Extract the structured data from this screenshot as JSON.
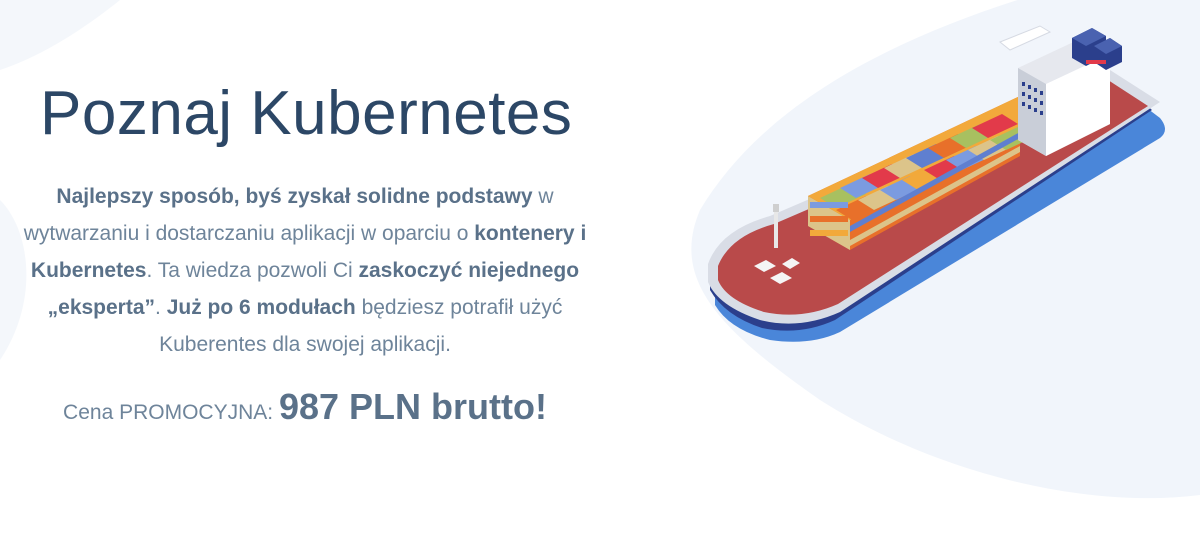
{
  "hero": {
    "title": "Poznaj Kubernetes",
    "description": {
      "p1_bold": "Najlepszy sposób, byś zyskał solidne podstawy",
      "p2": " w wytwarzaniu i dostarczaniu aplikacji w oparciu o ",
      "p3_bold": "kontenery i Kubernetes",
      "p4": ". Ta wiedza pozwoli Ci ",
      "p5_bold": "zaskoczyć niejednego „eksperta”",
      "p6": ". ",
      "p7_bold": "Już po 6 modułach",
      "p8": " będziesz potrafił użyć Kuberentes dla swojej aplikacji."
    },
    "price_label": "Cena PROMOCYJNA: ",
    "price_value": "987 PLN brutto!"
  },
  "illustration": {
    "icon": "container-ship-icon",
    "colors": {
      "background_blob": "#f1f5fb",
      "hull_top": "#b94a4a",
      "hull_side": "#2b3f8c",
      "hull_waterline": "#4a86d9",
      "container_palette": [
        "#f2a93b",
        "#e8702a",
        "#7b9be0",
        "#dcc48a",
        "#e23a4a",
        "#a8c060",
        "#5f7fd0"
      ]
    }
  }
}
